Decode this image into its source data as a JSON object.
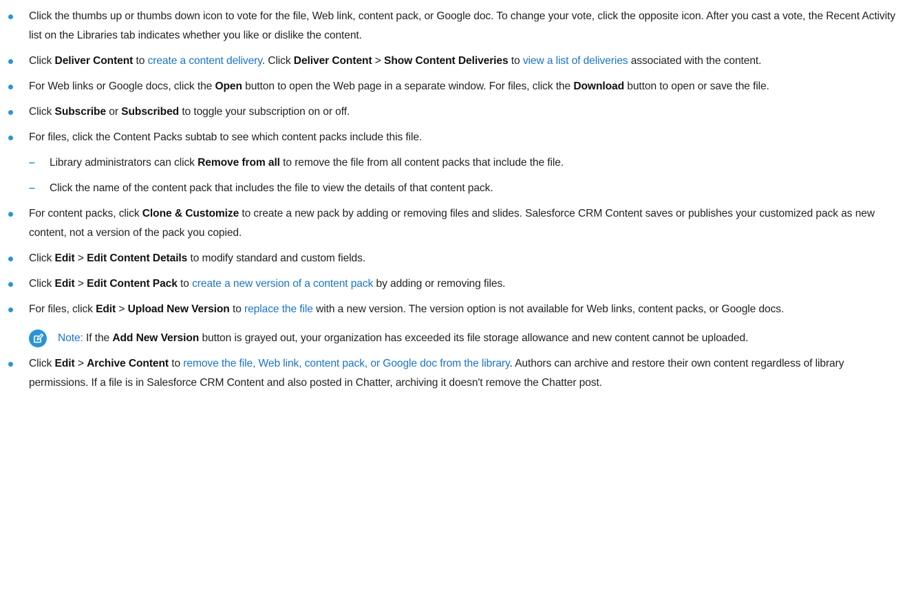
{
  "items": {
    "vote": {
      "t1": "Click the thumbs up or thumbs down icon to vote for the file, Web link, content pack, or Google doc. To change your vote, click the opposite icon. After you cast a vote, the Recent Activity list on the Libraries tab indicates whether you like or dislike the content."
    },
    "deliver": {
      "t1": "Click ",
      "b1": "Deliver Content",
      "t2": " to ",
      "l1": "create a content delivery",
      "t3": ". Click ",
      "b2": "Deliver Content",
      "t4": " > ",
      "b3": "Show Content Deliveries",
      "t5": " to ",
      "l2": "view a list of deliveries",
      "t6": " associated with the content."
    },
    "open": {
      "t1": "For Web links or Google docs, click the ",
      "b1": "Open",
      "t2": " button to open the Web page in a separate window. For files, click the ",
      "b2": "Download",
      "t3": " button to open or save the file."
    },
    "subscribe": {
      "t1": "Click ",
      "b1": "Subscribe",
      "t2": " or ",
      "b2": "Subscribed",
      "t3": " to toggle your subscription on or off."
    },
    "packs": {
      "t1": "For files, click the Content Packs subtab to see which content packs include this file.",
      "sub": {
        "remove": {
          "t1": "Library administrators can click ",
          "b1": "Remove from all",
          "t2": " to remove the file from all content packs that include the file."
        },
        "name": {
          "t1": "Click the name of the content pack that includes the file to view the details of that content pack."
        }
      }
    },
    "clone": {
      "t1": "For content packs, click ",
      "b1": "Clone & Customize",
      "t2": " to create a new pack by adding or removing files and slides. Salesforce CRM Content saves or publishes your customized pack as new content, not a version of the pack you copied."
    },
    "editdetails": {
      "t1": "Click ",
      "b1": "Edit",
      "t2": " > ",
      "b2": "Edit Content Details",
      "t3": " to modify standard and custom fields."
    },
    "editpack": {
      "t1": "Click ",
      "b1": "Edit",
      "t2": " > ",
      "b2": "Edit Content Pack",
      "t3": " to ",
      "l1": "create a new version of a content pack",
      "t4": " by adding or removing files."
    },
    "upload": {
      "t1": "For files, click ",
      "b1": "Edit",
      "t2": " > ",
      "b2": "Upload New Version",
      "t3": " to ",
      "l1": "replace the file",
      "t4": " with a new version. The version option is not available for Web links, content packs, or Google docs.",
      "note": {
        "label": "Note:",
        "t1": " If the ",
        "b1": "Add New Version",
        "t2": " button is grayed out, your organization has exceeded its file storage allowance and new content cannot be uploaded."
      }
    },
    "archive": {
      "t1": "Click ",
      "b1": "Edit",
      "t2": " > ",
      "b2": "Archive Content",
      "t3": " to ",
      "l1": "remove the file, Web link, content pack, or Google doc from the library",
      "t4": ". Authors can archive and restore their own content regardless of library permissions. If a file is in Salesforce CRM Content and also posted in Chatter, archiving it doesn't remove the Chatter post."
    }
  },
  "colors": {
    "bullet": "#2a94d6",
    "link": "#1a73c9",
    "note_icon": "#2a94d6"
  },
  "icons": {
    "bullet": "bullet-dot-icon",
    "note": "note-edit-icon"
  }
}
